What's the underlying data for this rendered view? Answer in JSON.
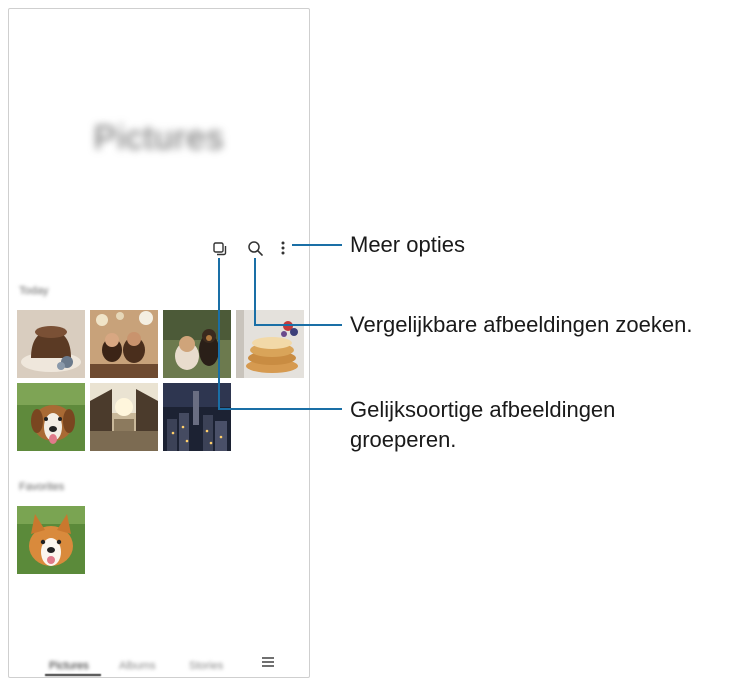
{
  "screen": {
    "title": "Pictures",
    "sections": {
      "main_label": "Today",
      "favorites_label": "Favorites"
    },
    "bottom_nav": [
      "Pictures",
      "Albums",
      "Stories"
    ],
    "icons": {
      "group": "group-similar-icon",
      "search": "search-icon",
      "more": "more-options-icon",
      "menu": "menu-icon"
    }
  },
  "callouts": {
    "more_options": "Meer opties",
    "search_similar": "Vergelijkbare afbeeldingen zoeken.",
    "group_similar_line1": "Gelijksoortige afbeeldingen",
    "group_similar_line2": "groeperen."
  },
  "colors": {
    "callout_line": "#1a6fa6",
    "text": "#1a1a1a"
  }
}
